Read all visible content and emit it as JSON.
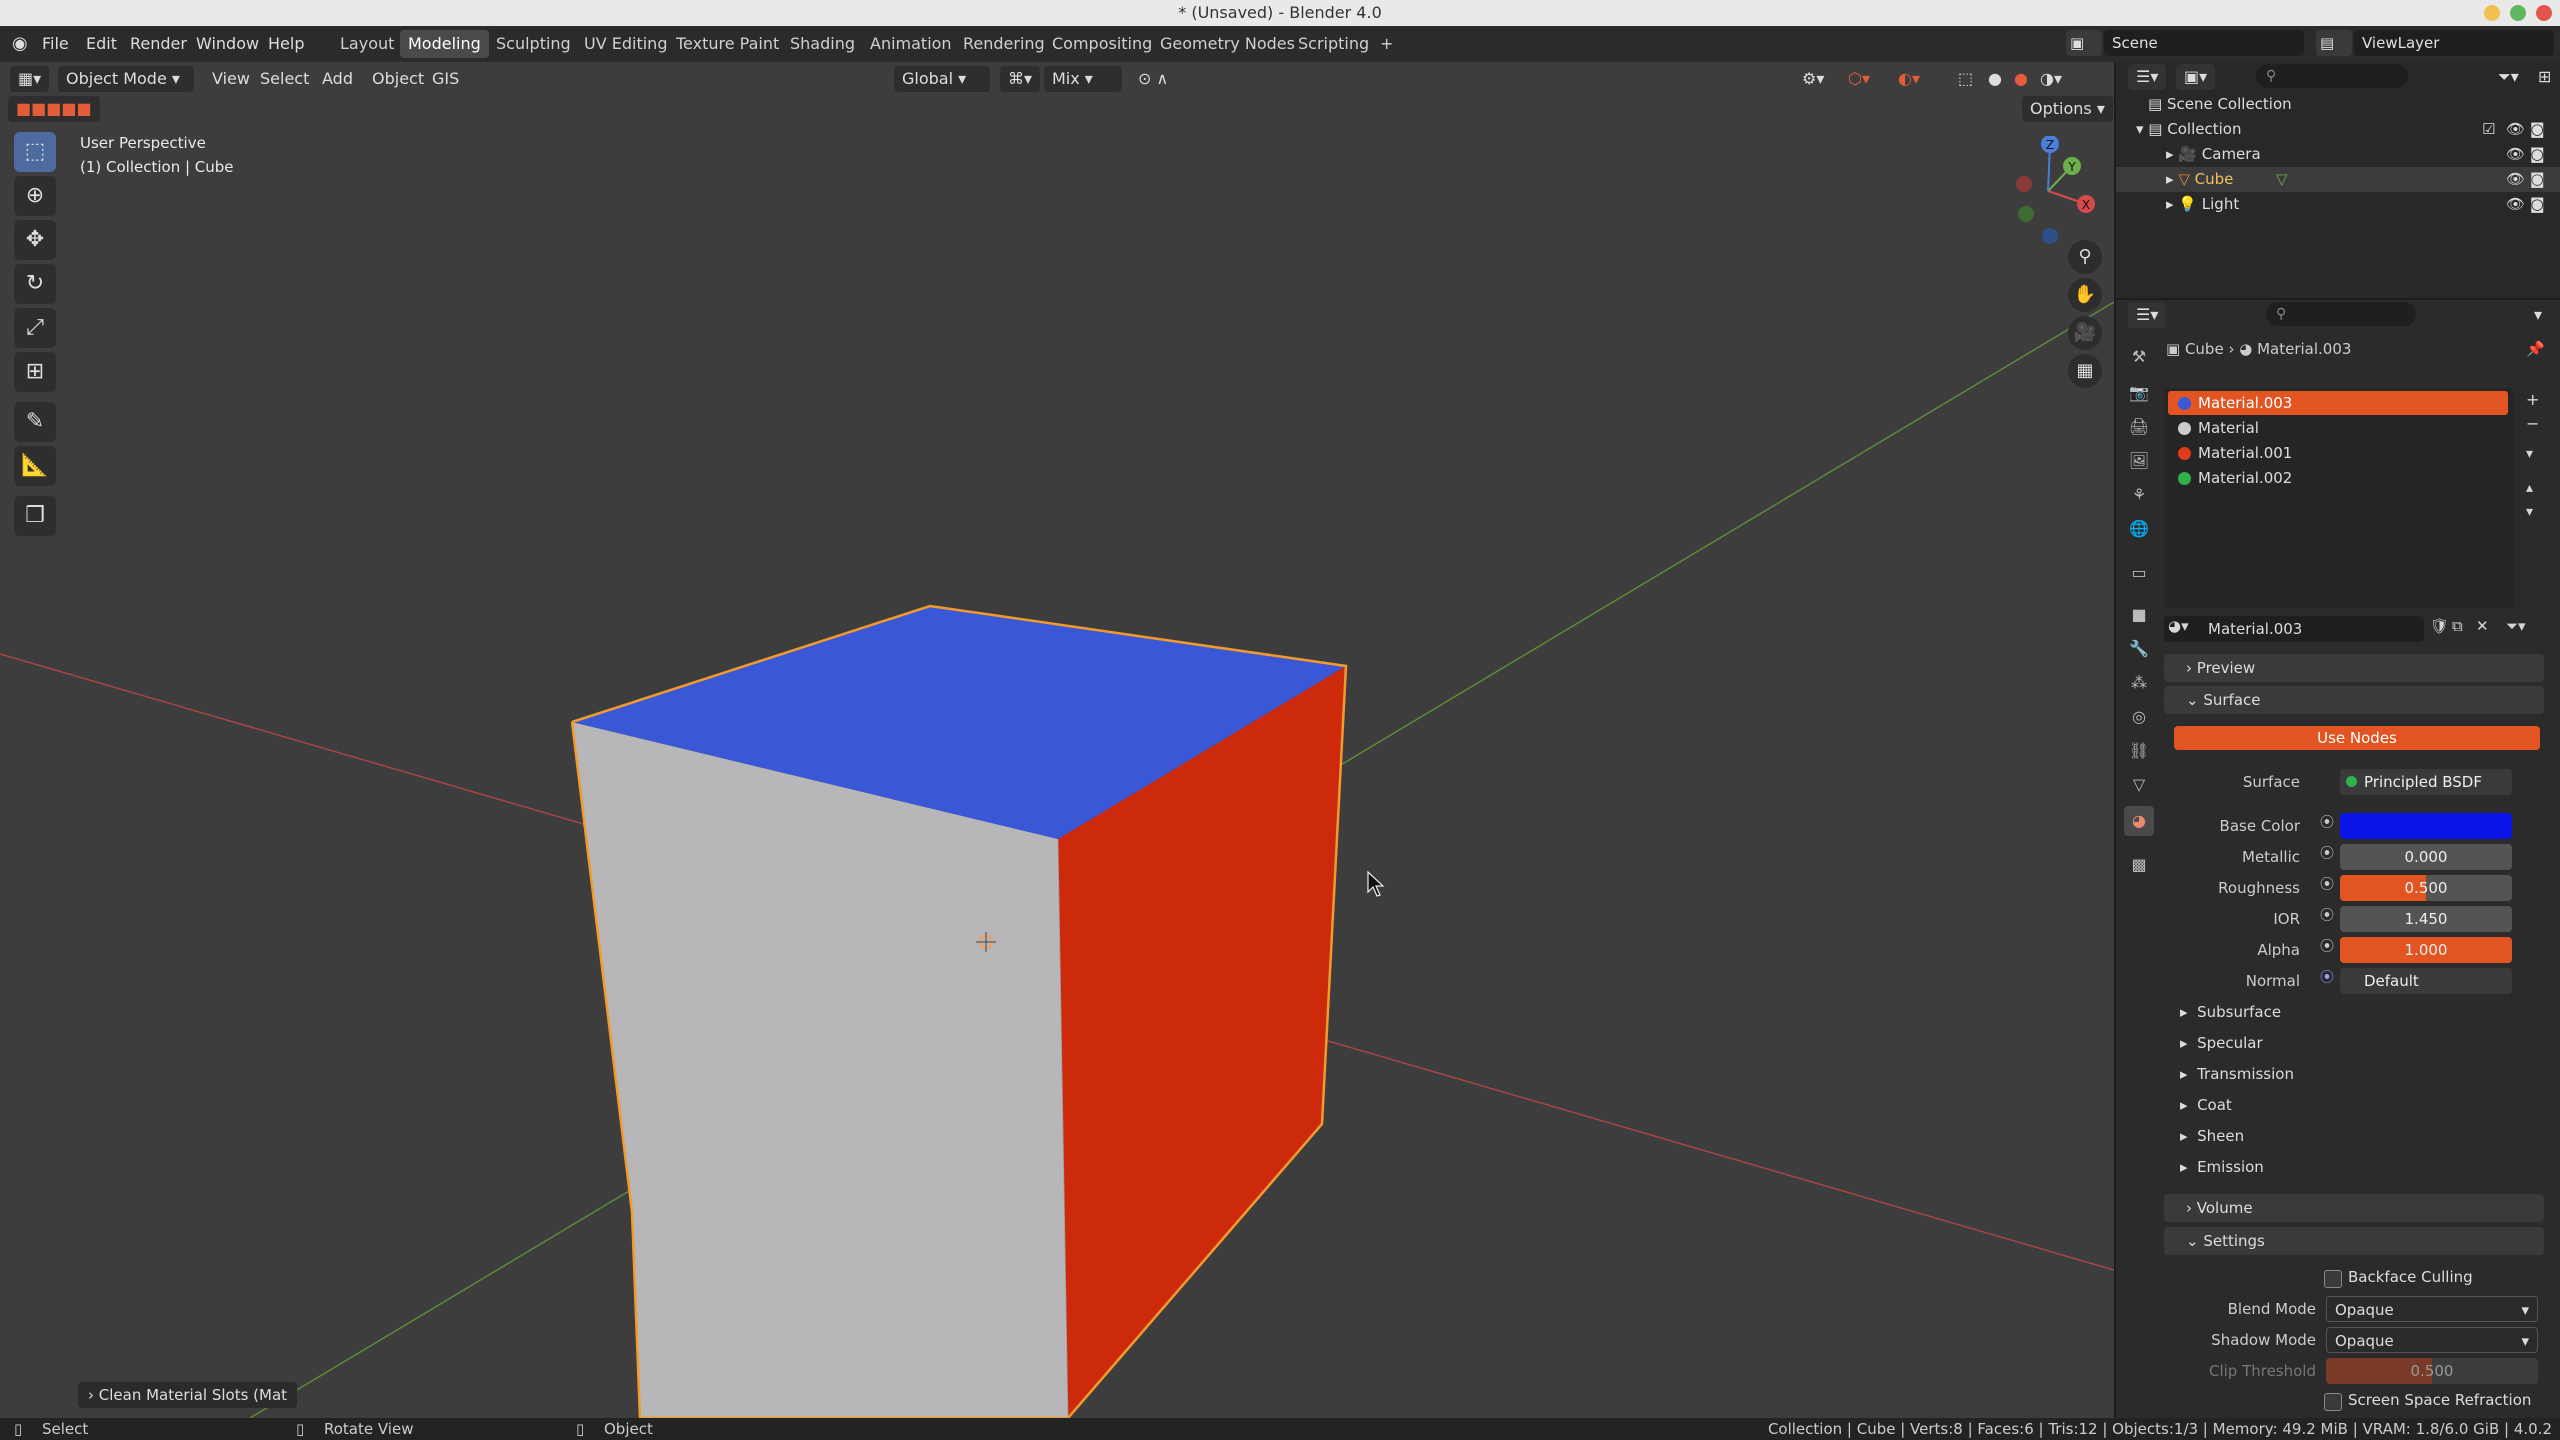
{
  "window": {
    "title": "* (Unsaved) - Blender 4.0"
  },
  "menus": [
    "File",
    "Edit",
    "Render",
    "Window",
    "Help"
  ],
  "workspaces": [
    "Layout",
    "Modeling",
    "Sculpting",
    "UV Editing",
    "Texture Paint",
    "Shading",
    "Animation",
    "Rendering",
    "Compositing",
    "Geometry Nodes",
    "Scripting"
  ],
  "active_workspace": "Modeling",
  "scene": {
    "name": "Scene",
    "view_layer": "ViewLayer"
  },
  "viewport": {
    "mode": "Object Mode",
    "menus": [
      "View",
      "Select",
      "Add",
      "Object",
      "GIS"
    ],
    "orientation": "Global",
    "proportional": "Mix",
    "options_label": "Options",
    "perspective": "User Perspective",
    "collection_info": "(1) Collection | Cube",
    "last_op": "Clean Material Slots (Mat",
    "gizmo_axes": {
      "x": "X",
      "y": "Y",
      "z": "Z"
    },
    "face_colors": {
      "top": "#3a58d6",
      "front": "#b7b7b9",
      "right": "#cc2a0a"
    }
  },
  "outliner": {
    "root": "Scene Collection",
    "collection": "Collection",
    "items": [
      {
        "name": "Camera"
      },
      {
        "name": "Cube"
      },
      {
        "name": "Light"
      }
    ]
  },
  "properties": {
    "breadcrumb": {
      "object": "Cube",
      "material": "Material.003"
    },
    "slots": [
      {
        "name": "Material.003",
        "color": "#3a58d6"
      },
      {
        "name": "Material",
        "color": "#cccccc"
      },
      {
        "name": "Material.001",
        "color": "#e03c1a"
      },
      {
        "name": "Material.002",
        "color": "#2fb14a"
      }
    ],
    "material_name": "Material.003",
    "panels": {
      "preview": "Preview",
      "surface": "Surface",
      "volume": "Volume",
      "settings": "Settings"
    },
    "use_nodes": "Use Nodes",
    "surface_label": "Surface",
    "surface_value": "Principled BSDF",
    "fields": [
      {
        "label": "Base Color",
        "value": ""
      },
      {
        "label": "Metallic",
        "value": "0.000"
      },
      {
        "label": "Roughness",
        "value": "0.500",
        "fill": 0.5
      },
      {
        "label": "IOR",
        "value": "1.450"
      },
      {
        "label": "Alpha",
        "value": "1.000",
        "fill": 1.0
      },
      {
        "label": "Normal",
        "value": "Default"
      }
    ],
    "base_color": "#0a14e6",
    "subpanels": [
      "Subsurface",
      "Specular",
      "Transmission",
      "Coat",
      "Sheen",
      "Emission"
    ],
    "settings": {
      "backface": "Backface Culling",
      "blend_label": "Blend Mode",
      "blend_value": "Opaque",
      "shadow_label": "Shadow Mode",
      "shadow_value": "Opaque",
      "clip_label": "Clip Threshold",
      "clip_value": "0.500",
      "ssr": "Screen Space Refraction"
    }
  },
  "statusbar": {
    "left": [
      {
        "label": "Select"
      },
      {
        "label": "Rotate View"
      },
      {
        "label": "Object"
      }
    ],
    "right": "Collection | Cube | Verts:8 | Faces:6 | Tris:12 | Objects:1/3 | Memory: 49.2 MiB | VRAM: 1.8/6.0 GiB | 4.0.2"
  }
}
